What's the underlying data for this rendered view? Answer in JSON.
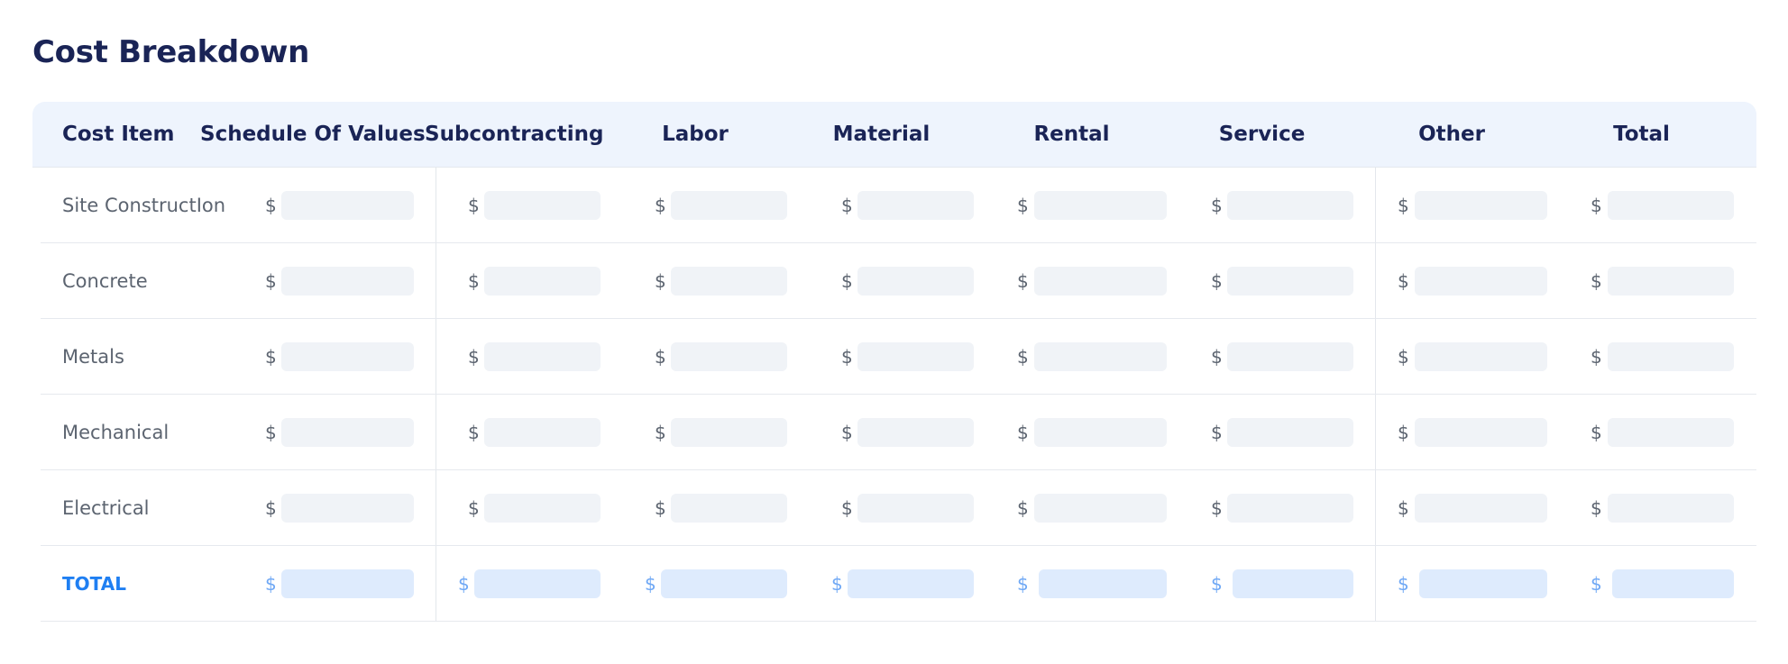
{
  "title": "Cost Breakdown",
  "columns": [
    "Cost Item",
    "Schedule Of Values",
    "Subcontracting",
    "Labor",
    "Material",
    "Rental",
    "Service",
    "Other",
    "Total"
  ],
  "currency_symbol": "$",
  "rows": [
    {
      "label": "Site ConstructIon"
    },
    {
      "label": "Concrete"
    },
    {
      "label": "Metals"
    },
    {
      "label": "Mechanical"
    },
    {
      "label": "Electrical"
    }
  ],
  "total_row": {
    "label": "TOTAL"
  },
  "colors": {
    "title": "#1a2456",
    "header_bg": "#eef4fd",
    "total_accent": "#1f7ff2",
    "field_bg": "#f0f3f7",
    "total_field_bg": "#deebfd"
  }
}
